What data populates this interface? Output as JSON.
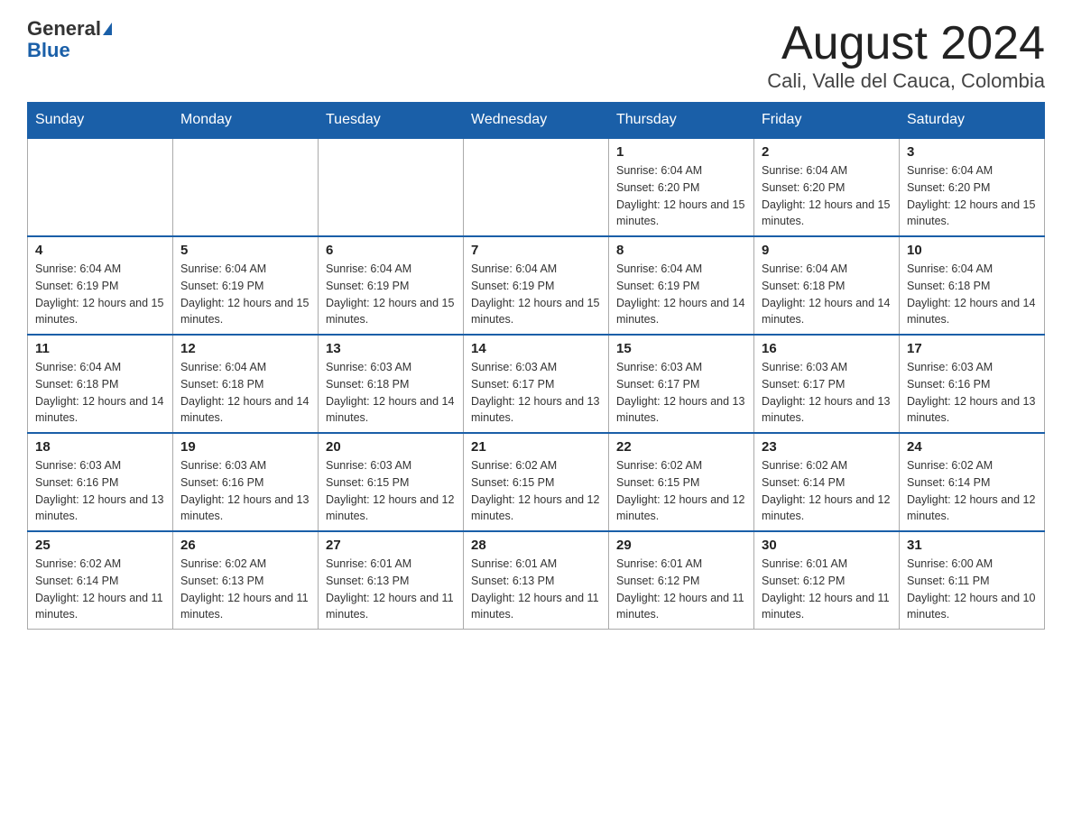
{
  "header": {
    "logo_general": "General",
    "logo_blue": "Blue",
    "month_title": "August 2024",
    "location": "Cali, Valle del Cauca, Colombia"
  },
  "days_of_week": [
    "Sunday",
    "Monday",
    "Tuesday",
    "Wednesday",
    "Thursday",
    "Friday",
    "Saturday"
  ],
  "weeks": [
    {
      "days": [
        {
          "number": "",
          "info": ""
        },
        {
          "number": "",
          "info": ""
        },
        {
          "number": "",
          "info": ""
        },
        {
          "number": "",
          "info": ""
        },
        {
          "number": "1",
          "info": "Sunrise: 6:04 AM\nSunset: 6:20 PM\nDaylight: 12 hours and 15 minutes."
        },
        {
          "number": "2",
          "info": "Sunrise: 6:04 AM\nSunset: 6:20 PM\nDaylight: 12 hours and 15 minutes."
        },
        {
          "number": "3",
          "info": "Sunrise: 6:04 AM\nSunset: 6:20 PM\nDaylight: 12 hours and 15 minutes."
        }
      ]
    },
    {
      "days": [
        {
          "number": "4",
          "info": "Sunrise: 6:04 AM\nSunset: 6:19 PM\nDaylight: 12 hours and 15 minutes."
        },
        {
          "number": "5",
          "info": "Sunrise: 6:04 AM\nSunset: 6:19 PM\nDaylight: 12 hours and 15 minutes."
        },
        {
          "number": "6",
          "info": "Sunrise: 6:04 AM\nSunset: 6:19 PM\nDaylight: 12 hours and 15 minutes."
        },
        {
          "number": "7",
          "info": "Sunrise: 6:04 AM\nSunset: 6:19 PM\nDaylight: 12 hours and 15 minutes."
        },
        {
          "number": "8",
          "info": "Sunrise: 6:04 AM\nSunset: 6:19 PM\nDaylight: 12 hours and 14 minutes."
        },
        {
          "number": "9",
          "info": "Sunrise: 6:04 AM\nSunset: 6:18 PM\nDaylight: 12 hours and 14 minutes."
        },
        {
          "number": "10",
          "info": "Sunrise: 6:04 AM\nSunset: 6:18 PM\nDaylight: 12 hours and 14 minutes."
        }
      ]
    },
    {
      "days": [
        {
          "number": "11",
          "info": "Sunrise: 6:04 AM\nSunset: 6:18 PM\nDaylight: 12 hours and 14 minutes."
        },
        {
          "number": "12",
          "info": "Sunrise: 6:04 AM\nSunset: 6:18 PM\nDaylight: 12 hours and 14 minutes."
        },
        {
          "number": "13",
          "info": "Sunrise: 6:03 AM\nSunset: 6:18 PM\nDaylight: 12 hours and 14 minutes."
        },
        {
          "number": "14",
          "info": "Sunrise: 6:03 AM\nSunset: 6:17 PM\nDaylight: 12 hours and 13 minutes."
        },
        {
          "number": "15",
          "info": "Sunrise: 6:03 AM\nSunset: 6:17 PM\nDaylight: 12 hours and 13 minutes."
        },
        {
          "number": "16",
          "info": "Sunrise: 6:03 AM\nSunset: 6:17 PM\nDaylight: 12 hours and 13 minutes."
        },
        {
          "number": "17",
          "info": "Sunrise: 6:03 AM\nSunset: 6:16 PM\nDaylight: 12 hours and 13 minutes."
        }
      ]
    },
    {
      "days": [
        {
          "number": "18",
          "info": "Sunrise: 6:03 AM\nSunset: 6:16 PM\nDaylight: 12 hours and 13 minutes."
        },
        {
          "number": "19",
          "info": "Sunrise: 6:03 AM\nSunset: 6:16 PM\nDaylight: 12 hours and 13 minutes."
        },
        {
          "number": "20",
          "info": "Sunrise: 6:03 AM\nSunset: 6:15 PM\nDaylight: 12 hours and 12 minutes."
        },
        {
          "number": "21",
          "info": "Sunrise: 6:02 AM\nSunset: 6:15 PM\nDaylight: 12 hours and 12 minutes."
        },
        {
          "number": "22",
          "info": "Sunrise: 6:02 AM\nSunset: 6:15 PM\nDaylight: 12 hours and 12 minutes."
        },
        {
          "number": "23",
          "info": "Sunrise: 6:02 AM\nSunset: 6:14 PM\nDaylight: 12 hours and 12 minutes."
        },
        {
          "number": "24",
          "info": "Sunrise: 6:02 AM\nSunset: 6:14 PM\nDaylight: 12 hours and 12 minutes."
        }
      ]
    },
    {
      "days": [
        {
          "number": "25",
          "info": "Sunrise: 6:02 AM\nSunset: 6:14 PM\nDaylight: 12 hours and 11 minutes."
        },
        {
          "number": "26",
          "info": "Sunrise: 6:02 AM\nSunset: 6:13 PM\nDaylight: 12 hours and 11 minutes."
        },
        {
          "number": "27",
          "info": "Sunrise: 6:01 AM\nSunset: 6:13 PM\nDaylight: 12 hours and 11 minutes."
        },
        {
          "number": "28",
          "info": "Sunrise: 6:01 AM\nSunset: 6:13 PM\nDaylight: 12 hours and 11 minutes."
        },
        {
          "number": "29",
          "info": "Sunrise: 6:01 AM\nSunset: 6:12 PM\nDaylight: 12 hours and 11 minutes."
        },
        {
          "number": "30",
          "info": "Sunrise: 6:01 AM\nSunset: 6:12 PM\nDaylight: 12 hours and 11 minutes."
        },
        {
          "number": "31",
          "info": "Sunrise: 6:00 AM\nSunset: 6:11 PM\nDaylight: 12 hours and 10 minutes."
        }
      ]
    }
  ]
}
